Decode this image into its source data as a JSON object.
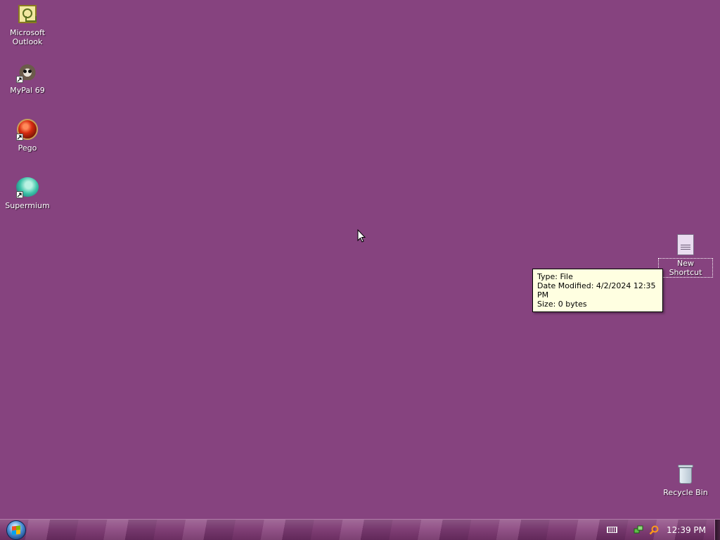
{
  "desktop": {
    "background_color": "#86437f",
    "icons": [
      {
        "label": "Microsoft\nOutlook",
        "icon": "outlook-icon",
        "shortcut": false
      },
      {
        "label": "MyPal 69",
        "icon": "raccoon-icon",
        "shortcut": true
      },
      {
        "label": "Pego",
        "icon": "red-ball-icon",
        "shortcut": true
      },
      {
        "label": "Supermium",
        "icon": "teal-ball-icon",
        "shortcut": true
      },
      {
        "label": "New Shortcut",
        "icon": "file-icon",
        "shortcut": false,
        "selected": true
      },
      {
        "label": "Recycle Bin",
        "icon": "recycle-bin-icon",
        "shortcut": false
      }
    ]
  },
  "tooltip": {
    "lines": [
      "Type: File",
      "Date Modified: 4/2/2024 12:35 PM",
      "Size: 0 bytes"
    ]
  },
  "taskbar": {
    "start_icon": "start-orb-icon",
    "tray_icons": [
      "keyboard-icon",
      "network-icon",
      "search-icon"
    ],
    "clock": "12:39 PM"
  }
}
